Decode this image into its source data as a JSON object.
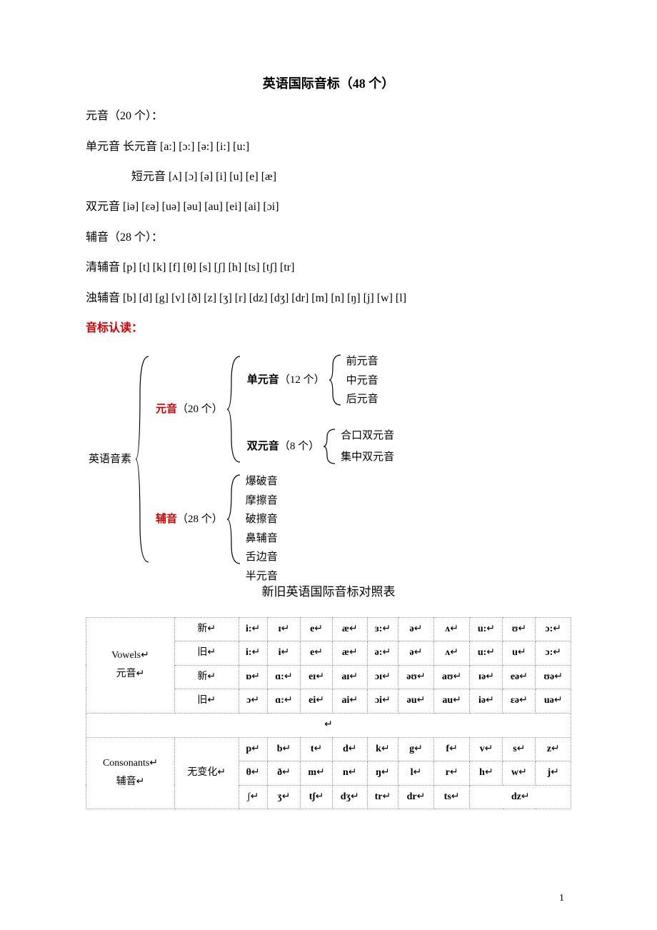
{
  "title": "英语国际音标（48 个）",
  "lines": {
    "l1": "元音（20 个）：",
    "l2": "单元音  长元音  [a:] [ɔ:] [ə:] [i:] [u:]",
    "l3": "短元音  [ʌ] [ɔ] [ə] [i] [u] [e] [æ]",
    "l4": "双元音  [iə] [ɛə] [uə] [əu] [au] [ei] [ai] [ɔi]",
    "l5": "辅音（28 个）：",
    "l6": "清辅音  [p] [t] [k] [f] [θ] [s] [ʃ] [h] [ts] [tʃ] [tr]",
    "l7": "浊辅音  [b] [d] [g] [v] [ð] [z] [ʒ] [r] [dz] [dʒ] [dr] [m] [n] [ŋ] [j] [w] [l]"
  },
  "section_label": "音标认读：",
  "hier": {
    "root": "英语音素",
    "vowel": "元音",
    "vowel_count": "（20 个）",
    "consonant": "辅音",
    "consonant_count": "（28 个）",
    "mono": "单元音",
    "mono_count": "（12 个）",
    "diph": "双元音",
    "diph_count": "（8 个）",
    "mono_items": [
      "前元音",
      "中元音",
      "后元音"
    ],
    "diph_items": [
      "合口双元音",
      "集中双元音"
    ],
    "cons_items": [
      "爆破音",
      "摩擦音",
      "破擦音",
      "鼻辅音",
      "舌边音",
      "半元音"
    ]
  },
  "subtitle": "新旧英语国际音标对照表",
  "table": {
    "vowels_label_en": "Vowels",
    "vowels_label_cn": "元音",
    "cons_label_en": "Consonants",
    "cons_label_cn": "辅音",
    "no_change": "无变化",
    "new": "新",
    "old": "旧",
    "r1": [
      "i:",
      "ɪ",
      "e",
      "æ",
      "ɜ:",
      "ə",
      "ʌ",
      "u:",
      "ʊ",
      "ɔ:"
    ],
    "r2": [
      "i:",
      "i",
      "e",
      "æ",
      "ə:",
      "ə",
      "ʌ",
      "u:",
      "u",
      "ɔ:"
    ],
    "r3": [
      "ɒ",
      "ɑ:",
      "eɪ",
      "aɪ",
      "ɔɪ",
      "əʊ",
      "aʊ",
      "ɪə",
      "eə",
      "ʊə"
    ],
    "r4": [
      "ɔ",
      "ɑ:",
      "ei",
      "ai",
      "ɔi",
      "əu",
      "au",
      "iə",
      "ɛə",
      "uə"
    ],
    "c1": [
      "p",
      "b",
      "t",
      "d",
      "k",
      "g",
      "f",
      "v",
      "s",
      "z"
    ],
    "c2": [
      "θ",
      "ð",
      "m",
      "n",
      "ŋ",
      "l",
      "r",
      "h",
      "w",
      "j"
    ],
    "c3": [
      "ʃ",
      "ʒ",
      "tʃ",
      "dʒ",
      "tr",
      "dr",
      "ts",
      "dz"
    ]
  },
  "page_num": "1"
}
